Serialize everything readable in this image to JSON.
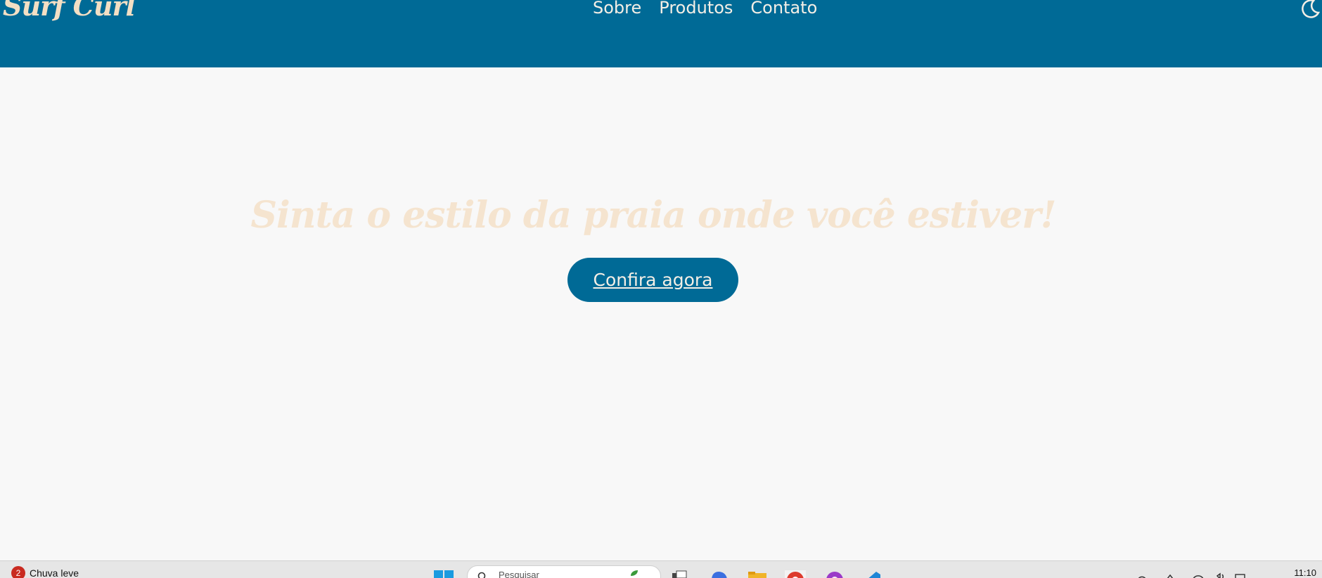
{
  "header": {
    "logo": "Surf Curl",
    "nav": [
      "Sobre",
      "Produtos",
      "Contato"
    ],
    "theme_icon": "moon-icon"
  },
  "hero": {
    "title": "Sinta o estilo da praia onde você estiver!",
    "cta_label": "Confira agora"
  },
  "taskbar": {
    "weather_badge": "2",
    "weather_text": "Chuva leve",
    "search_placeholder": "Pesquisar",
    "clock": "11:10",
    "apps": [
      "windows-start-icon",
      "task-view-icon",
      "copilot-icon",
      "file-explorer-icon",
      "chrome-icon",
      "podcast-icon",
      "vscode-icon"
    ]
  },
  "colors": {
    "header_bg": "#006a96",
    "accent_cream": "#f3dfc4",
    "page_bg": "#f8f8f8"
  }
}
